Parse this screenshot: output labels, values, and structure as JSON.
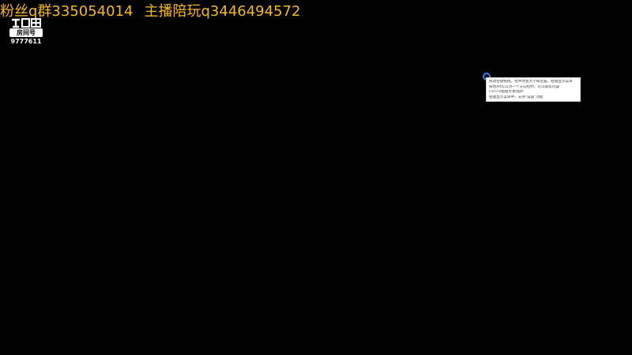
{
  "banner": {
    "part1": "粉丝q群335054014",
    "part2": "主播陪玩q3446494572",
    "color": "#f5b921"
  },
  "logo": {
    "badge_label": "房间号",
    "room_id": "9777611"
  },
  "tooltip": {
    "lines": [
      "拖动左键拖拽，拉伸改变大小和位置。右键显示菜单",
      "按住Alt可以对一个方向拉伸，可以裁剪内容",
      "Ctrl+V粘贴文本/图片",
      "右键显示菜单中，支持\"设置\"功能"
    ]
  }
}
